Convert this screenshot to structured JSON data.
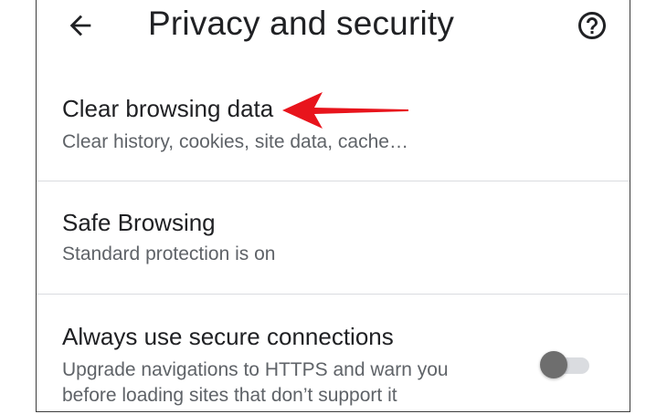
{
  "header": {
    "title": "Privacy and security",
    "back_icon": "arrow-left-icon",
    "help_icon": "help-circle-icon"
  },
  "settings": {
    "clear_browsing": {
      "title": "Clear browsing data",
      "subtitle": "Clear history, cookies, site data, cache…"
    },
    "safe_browsing": {
      "title": "Safe Browsing",
      "subtitle": "Standard protection is on"
    },
    "secure_connections": {
      "title": "Always use secure connections",
      "subtitle_line1": "Upgrade navigations to HTTPS and warn you",
      "subtitle_line2": "before loading sites that don’t support it",
      "enabled": false
    }
  },
  "annotation": {
    "arrow_color": "#e8141c"
  },
  "colors": {
    "text_primary": "#202124",
    "text_secondary": "#5f6368",
    "divider": "#dadce0",
    "toggle_thumb_off": "#6e6e6e"
  }
}
